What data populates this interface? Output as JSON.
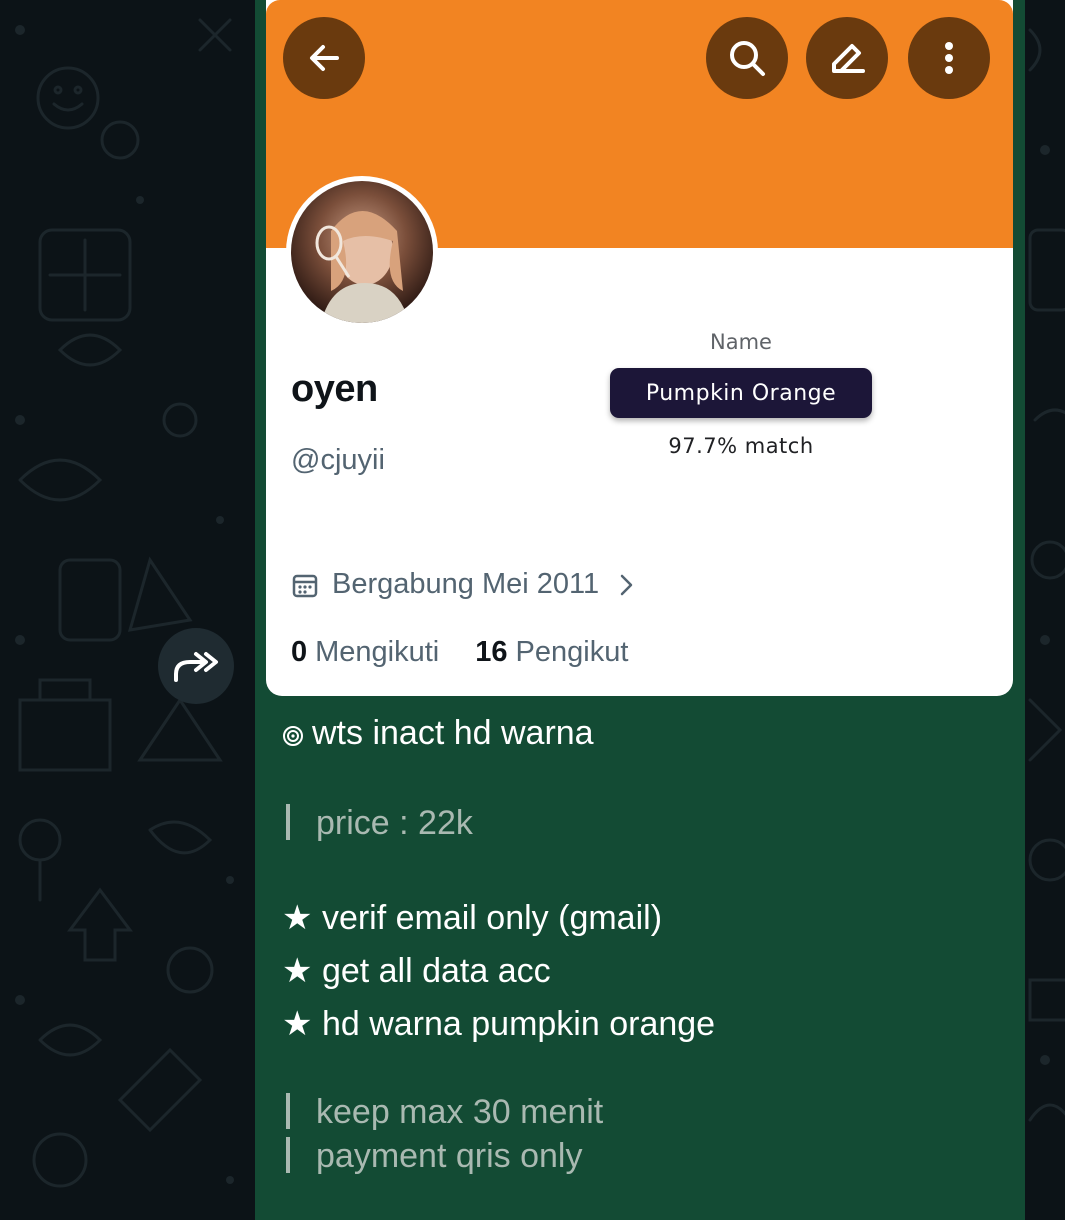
{
  "profile": {
    "display_name": "oyen",
    "handle": "@cjuyii",
    "joined": "Bergabung Mei 2011",
    "following_count": "0",
    "following_label": "Mengikuti",
    "followers_count": "16",
    "followers_label": "Pengikut",
    "banner_color": "#f28422"
  },
  "color_card": {
    "label": "Name",
    "color_name": "Pumpkin Orange",
    "match": "97.7% match"
  },
  "toolbar": {
    "back_icon": "arrow-left-icon",
    "search_icon": "search-icon",
    "edit_icon": "pencil-icon",
    "more_icon": "more-vertical-icon"
  },
  "message": {
    "headline": "wts inact hd warna",
    "price": "price : 22k",
    "features": [
      "verif email only (gmail)",
      "get all data acc",
      "hd warna pumpkin orange"
    ],
    "notes": [
      "keep max 30 menit",
      "payment qris only"
    ],
    "bubble_color": "#134b34"
  }
}
